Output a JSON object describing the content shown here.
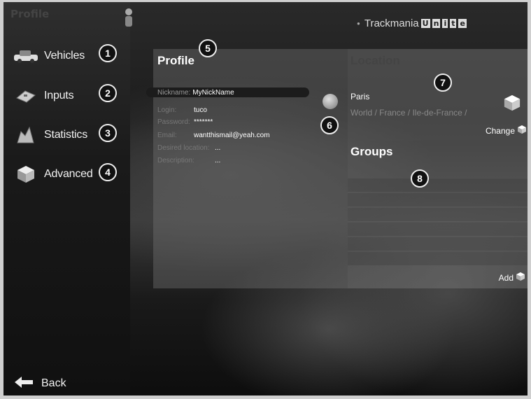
{
  "screen_title": "Profile",
  "logo": {
    "prefix": "Trackmania",
    "boxed": [
      "U",
      "n",
      "i",
      "t",
      "e"
    ],
    "accent": "#dddddd"
  },
  "menu": [
    {
      "label": "Vehicles",
      "icon": "car-icon",
      "badge": "1"
    },
    {
      "label": "Inputs",
      "icon": "input-device-icon",
      "badge": "2"
    },
    {
      "label": "Statistics",
      "icon": "statistics-icon",
      "badge": "3"
    },
    {
      "label": "Advanced",
      "icon": "cube-icon",
      "badge": "4"
    }
  ],
  "back_label": "Back",
  "profile": {
    "title": "Profile",
    "badge": "5",
    "nickname_key": "Nickname:",
    "nickname_value": "MyNickName",
    "fields": [
      {
        "key": "Login:",
        "value": "tuco"
      },
      {
        "key": "Password:",
        "value": "*******"
      },
      {
        "key": "Email:",
        "value": "wantthismail@yeah.com"
      },
      {
        "key": "Desired location:",
        "value": "..."
      },
      {
        "key": "Description:",
        "value": "..."
      }
    ],
    "refresh_badge": "6"
  },
  "location": {
    "title": "Location",
    "badge": "7",
    "city": "Paris",
    "path": "World / France / Ile-de-France /",
    "change_label": "Change"
  },
  "groups": {
    "title": "Groups",
    "badge": "8",
    "add_label": "Add"
  }
}
